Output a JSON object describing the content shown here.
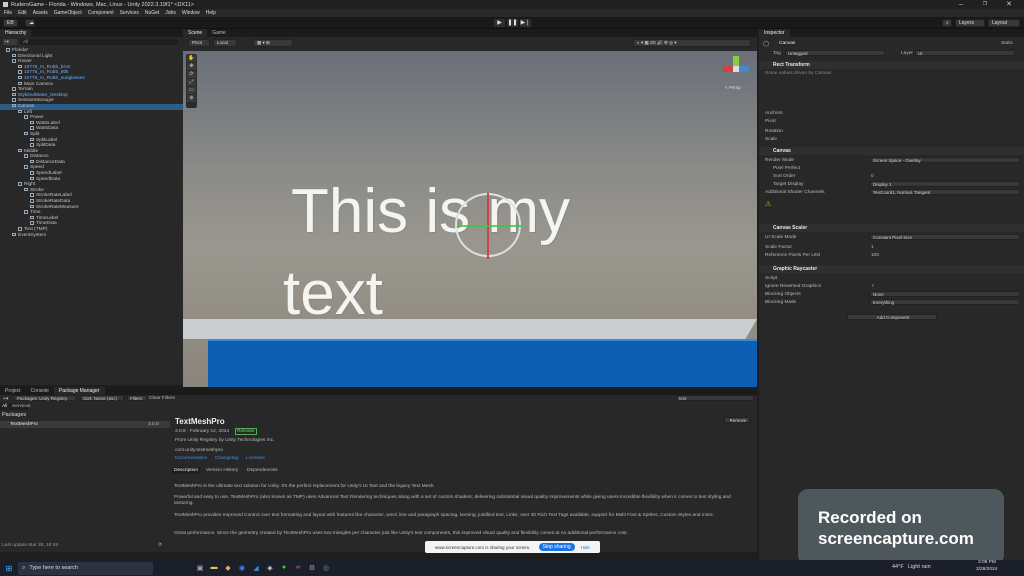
{
  "window": {
    "title": "RuderoGame - Florida - Windows, Mac, Linux - Unity 2022.3.19f1* <DX11>"
  },
  "menu": [
    "File",
    "Edit",
    "Assets",
    "GameObject",
    "Component",
    "Services",
    "NuGet",
    "Jobs",
    "Window",
    "Help"
  ],
  "toolbar": {
    "account": "EB",
    "layers": "Layers",
    "layout": "Layout"
  },
  "hierarchy": {
    "tab": "Hierarchy",
    "search_placeholder": "All",
    "rows": [
      {
        "t": "Florida*",
        "d": 0,
        "c": ""
      },
      {
        "t": "Directional Light",
        "d": 1,
        "c": ""
      },
      {
        "t": "Rower",
        "d": 1,
        "c": ""
      },
      {
        "t": "10776_m_Robb_bron",
        "d": 2,
        "c": "blue"
      },
      {
        "t": "10776_m_Robb_80k",
        "d": 2,
        "c": "blue"
      },
      {
        "t": "10776_m_Robb_sunglasses",
        "d": 2,
        "c": "blue"
      },
      {
        "t": "Main Camera",
        "d": 2,
        "c": ""
      },
      {
        "t": "Terrain",
        "d": 1,
        "c": ""
      },
      {
        "t": "StylizedWater_Desktop",
        "d": 1,
        "c": "blue"
      },
      {
        "t": "SessionManager",
        "d": 1,
        "c": ""
      },
      {
        "t": "Canvas",
        "d": 1,
        "c": "sel"
      },
      {
        "t": "Left",
        "d": 2,
        "c": ""
      },
      {
        "t": "Power",
        "d": 3,
        "c": ""
      },
      {
        "t": "WattsLabel",
        "d": 4,
        "c": ""
      },
      {
        "t": "WattsData",
        "d": 4,
        "c": ""
      },
      {
        "t": "Split",
        "d": 3,
        "c": ""
      },
      {
        "t": "SplitLabel",
        "d": 4,
        "c": ""
      },
      {
        "t": "SplitData",
        "d": 4,
        "c": ""
      },
      {
        "t": "Middle",
        "d": 2,
        "c": ""
      },
      {
        "t": "Distance",
        "d": 3,
        "c": ""
      },
      {
        "t": "DistanceData",
        "d": 4,
        "c": ""
      },
      {
        "t": "Speed",
        "d": 3,
        "c": ""
      },
      {
        "t": "SpeedLabel",
        "d": 4,
        "c": ""
      },
      {
        "t": "SpeedData",
        "d": 4,
        "c": ""
      },
      {
        "t": "Right",
        "d": 2,
        "c": ""
      },
      {
        "t": "Stroke",
        "d": 3,
        "c": ""
      },
      {
        "t": "StrokeRateLabel",
        "d": 4,
        "c": ""
      },
      {
        "t": "StrokeRateData",
        "d": 4,
        "c": ""
      },
      {
        "t": "StrokeRateMeasure",
        "d": 4,
        "c": ""
      },
      {
        "t": "Time",
        "d": 3,
        "c": ""
      },
      {
        "t": "TimeLabel",
        "d": 4,
        "c": ""
      },
      {
        "t": "TimeData",
        "d": 4,
        "c": ""
      },
      {
        "t": "Text (TMP)",
        "d": 2,
        "c": ""
      },
      {
        "t": "EventSystem",
        "d": 1,
        "c": ""
      }
    ]
  },
  "scene": {
    "tabs": [
      "Scene",
      "Game"
    ],
    "pivot": "Pivot",
    "local": "Local",
    "persp": "< Persp",
    "text_line1": "This is my",
    "text_line2": "text"
  },
  "inspector": {
    "tab": "Inspector",
    "object_name": "Canvas",
    "static_label": "Static",
    "tag_label": "Tag",
    "tag_value": "Untagged",
    "layer_label": "Layer",
    "layer_value": "UI",
    "rect_transform": "Rect Transform",
    "rect_note": "Some values driven by Canvas.",
    "anchors": "Anchors",
    "pivot": "Pivot",
    "rotation": "Rotation",
    "scale": "Scale",
    "canvas": "Canvas",
    "render_mode_label": "Render Mode",
    "render_mode_value": "Screen Space - Overlay",
    "pixel_perfect": "Pixel Perfect",
    "sort_order": "Sort Order",
    "sort_order_value": "0",
    "target_display": "Target Display",
    "target_display_value": "Display 1",
    "shader_channels": "Additional Shader Channels",
    "shader_channels_value": "TexCoord1, Normal, Tangent",
    "canvas_scaler": "Canvas Scaler",
    "ui_scale_mode": "UI Scale Mode",
    "ui_scale_value": "Constant Pixel Size",
    "scale_factor": "Scale Factor",
    "scale_factor_value": "1",
    "ref_ppu": "Reference Pixels Per Unit",
    "ref_ppu_value": "100",
    "graphic_raycaster": "Graphic Raycaster",
    "script": "Script",
    "ignore_reversed": "Ignore Reversed Graphics",
    "blocking_objects": "Blocking Objects",
    "blocking_objects_value": "None",
    "blocking_mask": "Blocking Mask",
    "blocking_mask_value": "Everything",
    "add_component": "Add Component"
  },
  "bottom": {
    "tabs": [
      "Project",
      "Console",
      "Package Manager"
    ],
    "packages_filter": "Packages: Unity Registry",
    "sort": "Sort: Name (asc)",
    "filters": "Filters",
    "clear_filters": "Clear Filters",
    "search_value": "text",
    "all_tab": "All",
    "services_tab": "Services",
    "packages_header": "Packages",
    "package_row": "TextMeshPro",
    "package_row_version": "3.0.8",
    "pkg_title": "TextMeshPro",
    "pkg_version": "3.0.8 · February 12, 2024",
    "pkg_badge": "Release",
    "pkg_from": "From Unity Registry by Unity Technologies Inc.",
    "pkg_id": "com.unity.textmeshpro",
    "links": [
      "Documentation",
      "Changelog",
      "Licenses"
    ],
    "remove": "Remove",
    "detail_tabs": [
      "Description",
      "Version History",
      "Dependencies"
    ],
    "desc1": "TextMeshPro is the ultimate text solution for Unity. It's the perfect replacement for Unity's UI Text and the legacy Text Mesh.",
    "desc2": "Powerful and easy to use, TextMeshPro (also known as TMP) uses Advanced Text Rendering techniques along with a set of custom shaders; delivering substantial visual quality improvements while giving users incredible flexibility when it comes to text styling and texturing.",
    "desc3": "TextMeshPro provides Improved Control over text formatting and layout with features like character, word, line and paragraph spacing, kerning, justified text, Links, over 30 Rich Text Tags available, support for Multi Font & Sprites, Custom Styles and more.",
    "desc4": "Great performance. Since the geometry created by TextMeshPro uses two triangles per character just like Unity's text components, this improved visual quality and flexibility comes at no additional performance cost.",
    "last_update": "Last update Mar 28, 16:49"
  },
  "share": {
    "text": "www.screencapture.com is sharing your screen.",
    "stop": "Stop sharing",
    "hide": "Hide"
  },
  "overlay": {
    "line1": "Recorded on",
    "line2": "screencapture.com"
  },
  "taskbar": {
    "search": "Type here to search",
    "weather_temp": "44°F",
    "weather_text": "Light rain",
    "time": "3:08 PM",
    "date": "3/28/2024"
  }
}
